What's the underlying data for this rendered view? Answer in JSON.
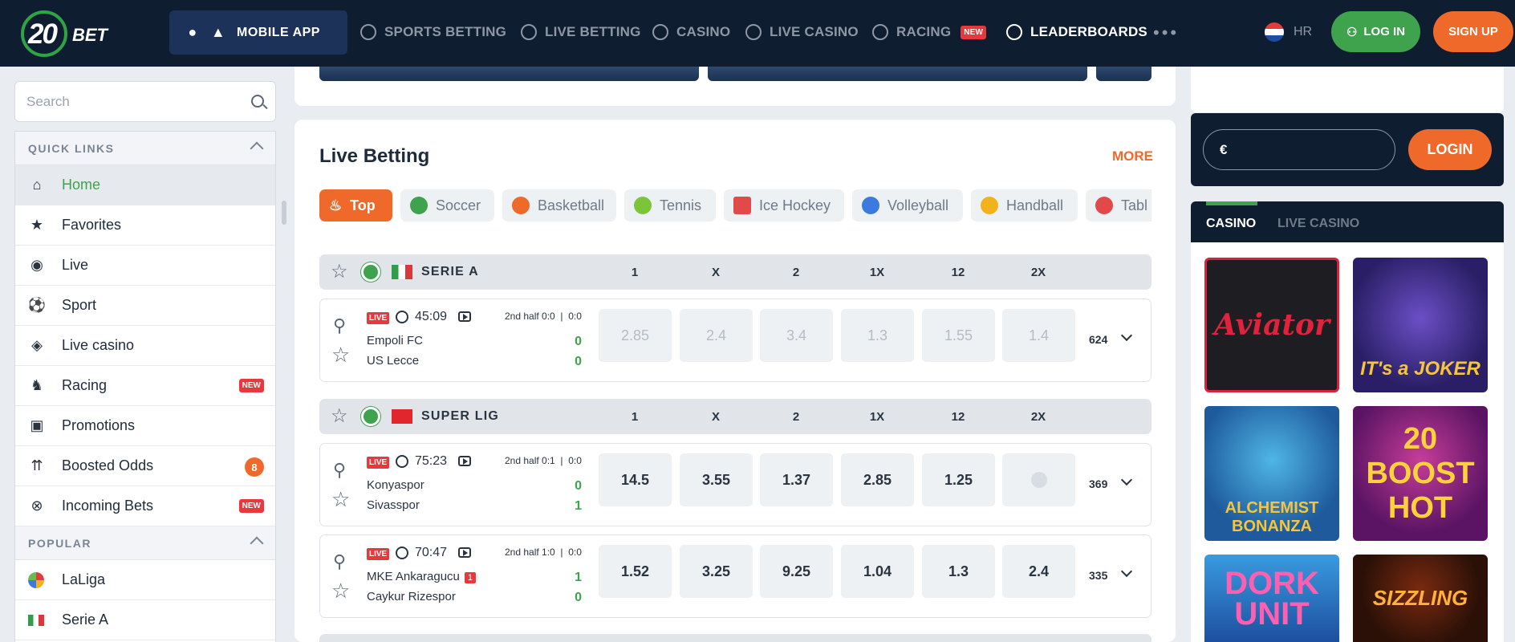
{
  "header": {
    "logo_num": "20",
    "logo_text": "BET",
    "mobile_app": "MOBILE APP",
    "nav": [
      "SPORTS BETTING",
      "LIVE BETTING",
      "CASINO",
      "LIVE CASINO",
      "RACING",
      "LEADERBOARDS"
    ],
    "racing_badge": "NEW",
    "more": "•••",
    "lang": "HR",
    "login": "LOG IN",
    "signup": "SIGN UP"
  },
  "search": {
    "placeholder": "Search"
  },
  "sidebar": {
    "quick_links_title": "QUICK LINKS",
    "items": [
      {
        "label": "Home",
        "icon": "home-icon"
      },
      {
        "label": "Favorites",
        "icon": "star-icon"
      },
      {
        "label": "Live",
        "icon": "broadcast-icon"
      },
      {
        "label": "Sport",
        "icon": "ball-icon"
      },
      {
        "label": "Live casino",
        "icon": "chip-icon"
      },
      {
        "label": "Racing",
        "icon": "horse-icon",
        "badge": "NEW"
      },
      {
        "label": "Promotions",
        "icon": "gift-icon"
      },
      {
        "label": "Boosted Odds",
        "icon": "boost-icon",
        "count": "8"
      },
      {
        "label": "Incoming Bets",
        "icon": "incoming-icon",
        "badge": "NEW"
      }
    ],
    "popular_title": "POPULAR",
    "popular": [
      {
        "label": "LaLiga"
      },
      {
        "label": "Serie A"
      }
    ]
  },
  "live_betting": {
    "title": "Live Betting",
    "more": "MORE",
    "tabs": [
      "Top",
      "Soccer",
      "Basketball",
      "Tennis",
      "Ice Hockey",
      "Volleyball",
      "Handball",
      "Tabl"
    ],
    "columns": [
      "1",
      "X",
      "2",
      "1X",
      "12",
      "2X"
    ],
    "leagues": [
      {
        "name": "SERIE A",
        "matches": [
          {
            "live": "LIVE",
            "time": "45:09",
            "half": "2nd half",
            "half_score": "0:0",
            "set_score": "0:0",
            "home": "Empoli FC",
            "away": "US Lecce",
            "home_score": "0",
            "away_score": "0",
            "odds": [
              "2.85",
              "2.4",
              "3.4",
              "1.3",
              "1.55",
              "1.4"
            ],
            "count": "624"
          }
        ]
      },
      {
        "name": "SUPER LIG",
        "matches": [
          {
            "live": "LIVE",
            "time": "75:23",
            "half": "2nd half",
            "half_score": "0:1",
            "set_score": "0:0",
            "home": "Konyaspor",
            "away": "Sivasspor",
            "home_score": "0",
            "away_score": "1",
            "odds": [
              "14.5",
              "3.55",
              "1.37",
              "2.85",
              "1.25",
              ""
            ],
            "count": "369"
          },
          {
            "live": "LIVE",
            "time": "70:47",
            "half": "2nd half",
            "half_score": "1:0",
            "set_score": "0:0",
            "home": "MKE Ankaragucu",
            "home_card": "1",
            "away": "Caykur Rizespor",
            "home_score": "1",
            "away_score": "0",
            "odds": [
              "1.52",
              "3.25",
              "9.25",
              "1.04",
              "1.3",
              "2.4"
            ],
            "count": "335"
          }
        ]
      }
    ]
  },
  "right": {
    "currency": "€",
    "login": "LOGIN",
    "tabs": [
      "CASINO",
      "LIVE CASINO"
    ],
    "games": [
      "Aviator",
      "IT's a JOKER",
      "ALCHEMIST BONANZA",
      "20 BOOST HOT",
      "DORK UNIT",
      "SIZZLING"
    ]
  },
  "colors": {
    "accent": "#ef6a2a",
    "green": "#3fa34d",
    "navy": "#0f1d31",
    "live_red": "#e8383d"
  }
}
